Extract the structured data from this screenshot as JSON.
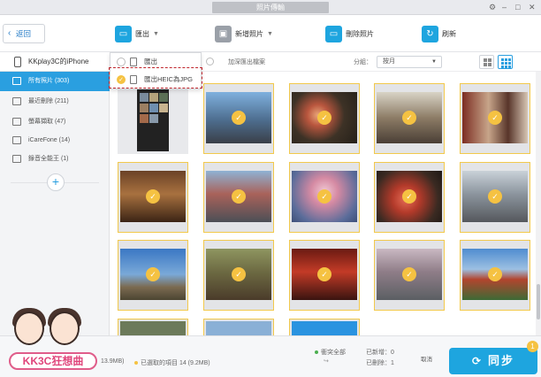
{
  "window": {
    "title": "照片傳輸"
  },
  "toolbar": {
    "back_label": "返回",
    "export_label": "匯出",
    "add_photo_label": "新增照片",
    "delete_label": "刪除照片",
    "refresh_label": "刷新"
  },
  "export_menu": {
    "items": [
      {
        "label": "匯出",
        "selected": false
      },
      {
        "label": "匯出HEIC為JPG",
        "selected": true
      }
    ]
  },
  "sidebar": {
    "device_name": "KKplay3C的iPhone",
    "items": [
      {
        "label": "所有照片 (303)",
        "active": true
      },
      {
        "label": "最近刪除 (211)",
        "active": false
      },
      {
        "label": "螢幕擷取 (47)",
        "active": false
      },
      {
        "label": "iCareFone (14)",
        "active": false
      },
      {
        "label": "錄音全能王 (1)",
        "active": false
      }
    ],
    "add_label": "+"
  },
  "filter": {
    "select_all_label": "加深匯出檔案",
    "group_label": "分組：",
    "group_value": "按月"
  },
  "bottom": {
    "left_text": "13.9MB)",
    "selected_text": "已選取的項目 14 (9.2MB)",
    "conflict_label": "衝突全部",
    "added_label": "已新增：0",
    "deleted_label": "已刪除：1",
    "cancel_label": "取消",
    "sync_label": "同步",
    "badge_count": "1"
  },
  "colors": {
    "accent": "#1ea5df",
    "active_item": "#2a9fe0",
    "check": "#f5c242",
    "highlight": "#c0262d"
  },
  "logo_text": "KK3C狂想曲"
}
